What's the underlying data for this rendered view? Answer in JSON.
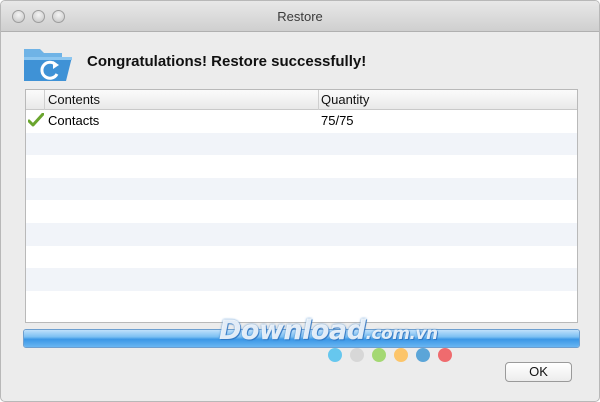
{
  "window": {
    "title": "Restore"
  },
  "header": {
    "icon": "restore-folder-icon",
    "message": "Congratulations! Restore successfully!"
  },
  "table": {
    "columns": [
      "Contents",
      "Quantity"
    ],
    "rows": [
      {
        "status_icon": "checkmark-icon",
        "contents": "Contacts",
        "quantity": "75/75"
      }
    ],
    "empty_rows": 8
  },
  "progress": {
    "value": 1.0
  },
  "watermark": {
    "text": "Download",
    "suffix": ".com.vn",
    "dot_colors": [
      "#66c7ee",
      "#d7d7d7",
      "#a4d873",
      "#fcc56a",
      "#5ba5d8",
      "#ef6b6e"
    ]
  },
  "footer": {
    "ok_label": "OK"
  },
  "colors": {
    "accent": "#3b97e6",
    "check": "#6aa52e",
    "folder": "#4a9ad8"
  }
}
